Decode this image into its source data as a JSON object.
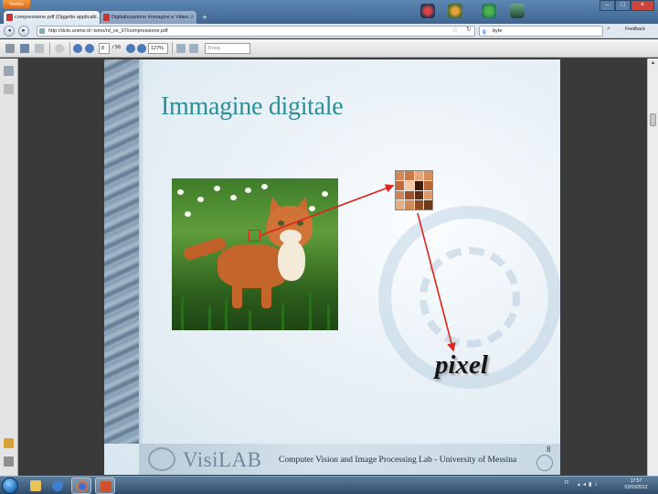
{
  "browser": {
    "app_button": "Firefox",
    "tabs": [
      {
        "label": "compressione.pdf (Oggetto applicati...",
        "active": true
      },
      {
        "label": "Digitalizzazione Immagine e Video...",
        "active": false
      }
    ],
    "new_tab": "+",
    "url": "http://dcto.unime.it/~ismo/rd_ce_07/compressione.pdf",
    "search_engine": "g",
    "search_value": "byte",
    "feedback": "Feedback"
  },
  "pdf_toolbar": {
    "page_current": "8",
    "page_total": "/ 56",
    "zoom": "127%",
    "find_placeholder": "Trova"
  },
  "slide": {
    "title": "Immagine digitale",
    "pixel_label": "pixel",
    "footer_brand": "VisiLAB",
    "footer_lab": "Computer Vision and Image Processing Lab - University of Messina",
    "page_number": "8",
    "pixel_grid_colors": [
      "#d38a52",
      "#c97945",
      "#e6a87b",
      "#d78f5a",
      "#c26a3a",
      "#f0c8a4",
      "#3c1a0c",
      "#b7673a",
      "#ce8754",
      "#a0512a",
      "#5a2d16",
      "#dc9766",
      "#e5ad80",
      "#cf8a55",
      "#8b4a24",
      "#6e3b1a"
    ]
  },
  "taskbar": {
    "lang": "IT",
    "time": "17:57",
    "date": "02/03/2012"
  },
  "colors": {
    "slide_title": "#2e8e96",
    "arrow": "#e0231b"
  }
}
